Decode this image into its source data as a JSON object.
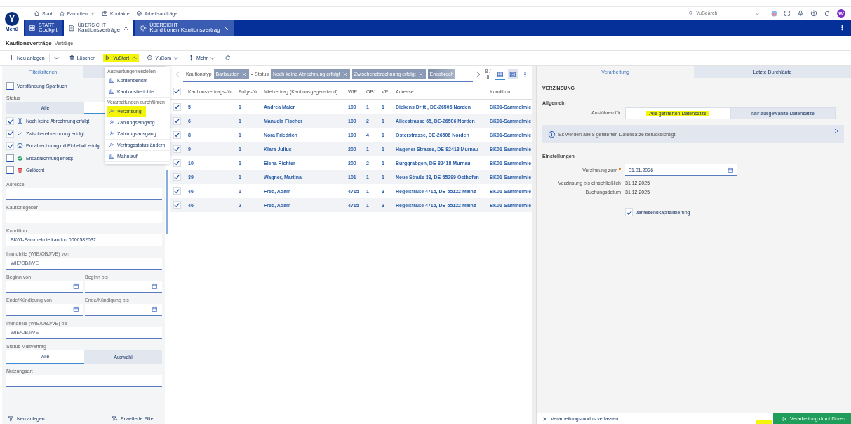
{
  "header": {
    "logo_letter": "Y",
    "menu_label": "Menü",
    "nav": [
      {
        "label": "Start",
        "kind": "home"
      },
      {
        "label": "Favoriten",
        "kind": "favorites"
      },
      {
        "label": "Kontakte",
        "kind": "contacts"
      },
      {
        "label": "Arbeitsaufträge",
        "kind": "tasks"
      }
    ],
    "search": {
      "placeholder": "YuSearch"
    },
    "avatar": "W"
  },
  "tabs": [
    {
      "caption": "START",
      "label": "Cockpit",
      "kind": "start",
      "selected": false,
      "closable": false
    },
    {
      "caption": "ÜBERSICHT",
      "label": "Kautionsverträge",
      "kind": "list",
      "selected": true,
      "closable": true
    },
    {
      "caption": "ÜBERSICHT",
      "label": "Konditionen Kautionsvertrag",
      "kind": "conditions",
      "selected": false,
      "closable": true
    }
  ],
  "page": {
    "title": "Kautionsverträge",
    "subtitle": "Verträge"
  },
  "toolbar": [
    {
      "label": "Neu anlegen",
      "kind": "new"
    },
    {
      "label": "Löschen",
      "kind": "delete"
    },
    {
      "label": "YuStart",
      "kind": "start",
      "expanded": true,
      "highlighted": true
    },
    {
      "label": "YuCom",
      "kind": "com",
      "expanded": false,
      "highlighted": false
    },
    {
      "label": "Mehr",
      "kind": "more",
      "expanded": false,
      "highlighted": false
    },
    {
      "kind": "refresh"
    }
  ],
  "menu": {
    "sections": [
      {
        "title": "Auswertungen erstellen",
        "items": [
          {
            "label": "Kontenbericht",
            "kind": "report",
            "highlighted": false
          },
          {
            "label": "Kautionsberichte",
            "kind": "report",
            "highlighted": false
          }
        ]
      },
      {
        "title": "Verarbeitungen durchführen",
        "items": [
          {
            "label": "Verzinsung",
            "kind": "process",
            "highlighted": true
          },
          {
            "label": "Zahlungseingang",
            "kind": "process",
            "highlighted": false
          },
          {
            "label": "Zahlungsausgang",
            "kind": "process",
            "highlighted": false
          },
          {
            "label": "Vertragsstatus ändern",
            "kind": "process",
            "highlighted": false
          },
          {
            "label": "Mahnlauf",
            "kind": "report",
            "highlighted": false
          }
        ]
      }
    ]
  },
  "filter": {
    "tabs": [
      {
        "label": "Filterkriterien",
        "selected": true
      }
    ],
    "pledge": {
      "label": "Verpfändung Sparbuch",
      "checked": false
    },
    "status": {
      "label": "Status",
      "options": [
        {
          "label": "Alle",
          "selected": false
        },
        {
          "selected": true
        }
      ],
      "items": [
        {
          "label": "Noch keine Abrechnung erfolgt",
          "kind": "open",
          "checked": true
        },
        {
          "label": "Zwischenabrechnung erfolgt",
          "kind": "interim",
          "checked": true
        },
        {
          "label": "Endabrechnung mit Einbehalt erfolg",
          "kind": "retained",
          "checked": true
        },
        {
          "label": "Endabrechnung erfolgt",
          "kind": "final",
          "checked": false
        },
        {
          "label": "Gelöscht",
          "kind": "deleted",
          "checked": false
        }
      ]
    },
    "fields": [
      {
        "kind": "text",
        "label": "Adresse"
      },
      {
        "kind": "text",
        "label": "Kautionsgeber"
      },
      {
        "kind": "text",
        "label": "Kondition",
        "value": "BK01-Sammelmietkaution 0006582632"
      },
      {
        "kind": "text",
        "label": "Immobilie (WIE/OBJ/VE) von",
        "placeholder": "WIE/OBJ/VE"
      },
      {
        "kind": "dates",
        "labels": [
          "Beginn von",
          "Beginn bis"
        ]
      },
      {
        "kind": "dates",
        "labels": [
          "Ende/Kündigung von",
          "Ende/Kündigung bis"
        ]
      },
      {
        "kind": "text",
        "label": "Immobilie (WIE/OBJ/VE) bis",
        "placeholder": "WIE/OBJ/VE"
      },
      {
        "kind": "toggle",
        "label": "Status Mietvertrag",
        "options": [
          {
            "label": "Alle",
            "selected": true
          },
          {
            "label": "Auswahl",
            "selected": false
          }
        ]
      },
      {
        "kind": "text",
        "label": "Nutzungsart"
      }
    ],
    "footer": [
      {
        "label": "Neu anlegen",
        "kind": "new"
      },
      {
        "label": "Erweiterte Filter",
        "kind": "advanced"
      }
    ]
  },
  "filter_bar": {
    "groups": [
      {
        "label": "Kautionstyp",
        "chips": [
          {
            "label": "Barkaution",
            "faded": false
          }
        ]
      },
      {
        "label": "Status",
        "chips": [
          {
            "label": "Noch keine Abrechnung erfolgt",
            "faded": false
          },
          {
            "label": "Zwischenabrechnung erfolgt",
            "faded": false
          },
          {
            "label": "Endabrech",
            "faded": true
          }
        ]
      }
    ],
    "count": "8 / 8"
  },
  "table": {
    "all_checked": true,
    "columns": [
      "Kautionsvertrags-Nr.",
      "Folge-Nr.",
      "Mietvertrag (Kautionsgegenstand)",
      "WIE",
      "OBJ",
      "VE",
      "Adresse",
      "Kondition"
    ],
    "rows": [
      {
        "checked": true,
        "cells": [
          "5",
          "1",
          "Andrea Maier",
          "100",
          "1",
          "1",
          "Diekens Drift , DE-26506 Norden",
          "BK01-Sammelmie"
        ]
      },
      {
        "checked": true,
        "cells": [
          "6",
          "1",
          "Manuela Fischer",
          "100",
          "2",
          "1",
          "Alleestrasse 65, DE-26506 Norden",
          "BK01-Sammelmie"
        ]
      },
      {
        "checked": true,
        "cells": [
          "8",
          "1",
          "Nora Friedrich",
          "100",
          "4",
          "1",
          "Osterstrasse, DE-26506 Norden",
          "BK01-Sammelmie"
        ]
      },
      {
        "checked": true,
        "cells": [
          "9",
          "1",
          "Klara Julius",
          "200",
          "1",
          "1",
          "Hagener Strasse, DE-82418 Murnau",
          "BK01-Sammelmie"
        ]
      },
      {
        "checked": true,
        "cells": [
          "10",
          "1",
          "Elena Richter",
          "200",
          "2",
          "1",
          "Burggrabgen, DE-82418 Murnau",
          "BK01-Sammelmie"
        ]
      },
      {
        "checked": true,
        "cells": [
          "39",
          "1",
          "Wagner, Martina",
          "101",
          "1",
          "1",
          "Neue Straße 33, DE-55299 Osthofen",
          "BK01-Sammelmie"
        ]
      },
      {
        "checked": true,
        "cells": [
          "46",
          "1",
          "Fred, Adam",
          "4715",
          "1",
          "3",
          "Hegelstraße 4715, DE-55122 Mainz",
          "BK01-Sammelmie"
        ]
      },
      {
        "checked": true,
        "cells": [
          "46",
          "2",
          "Fred, Adam",
          "4715",
          "1",
          "3",
          "Hegelstraße 4715, DE-55122 Mainz",
          "BK01-Sammelmie"
        ]
      }
    ]
  },
  "process": {
    "tabs": [
      {
        "label": "Verarbeitung",
        "selected": true
      },
      {
        "label": "Letzte Durchläufe",
        "selected": false
      }
    ],
    "title": "VERZINSUNG",
    "general": {
      "title": "Allgemein",
      "label": "Ausführen für",
      "options": [
        {
          "label": "Alle gefilterten Datensätze",
          "selected": true,
          "highlighted": true
        },
        {
          "label": "Nur ausgewählte Datensätze",
          "selected": false,
          "highlighted": false
        }
      ],
      "info": "Es werden alle 8 gefilterten Datensätze berücksichtigt."
    },
    "settings": {
      "title": "Einstellungen",
      "rows": [
        {
          "kind": "date",
          "label": "Verzinsung zum",
          "required": true,
          "value": "01.01.2026"
        },
        {
          "kind": "text",
          "label": "Verzinsung bis einschließlich",
          "required": false,
          "value": "31.12.2025"
        },
        {
          "kind": "text",
          "label": "Buchungsdatum",
          "required": false,
          "value": "31.12.2025"
        }
      ],
      "checkbox": {
        "label": "Jahresendkapitalisierung",
        "checked": true
      }
    },
    "cancel": "Verarbeitungsmodus verlassen",
    "run": {
      "label": "Verarbeitung durchführen",
      "highlighted": true
    }
  }
}
